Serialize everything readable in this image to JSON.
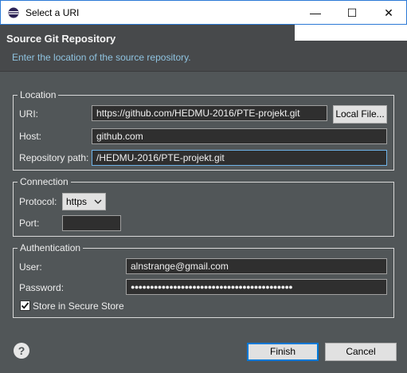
{
  "window": {
    "title": "Select a URI",
    "minimize_glyph": "—",
    "maximize_glyph": "☐",
    "close_glyph": "✕"
  },
  "banner": {
    "heading": "Source Git Repository",
    "description": "Enter the location of the source repository."
  },
  "location": {
    "legend": "Location",
    "uri_label": "URI:",
    "uri_value": "https://github.com/HEDMU-2016/PTE-projekt.git",
    "local_file_label": "Local File...",
    "host_label": "Host:",
    "host_value": "github.com",
    "repo_path_label": "Repository path:",
    "repo_path_value": "/HEDMU-2016/PTE-projekt.git"
  },
  "connection": {
    "legend": "Connection",
    "protocol_label": "Protocol:",
    "protocol_value": "https",
    "port_label": "Port:",
    "port_value": ""
  },
  "authentication": {
    "legend": "Authentication",
    "user_label": "User:",
    "user_value": "alnstrange@gmail.com",
    "password_label": "Password:",
    "password_value": "●●●●●●●●●●●●●●●●●●●●●●●●●●●●●●●●●●●●●●●●●●",
    "store_label": "Store in Secure Store",
    "store_checked": true
  },
  "footer": {
    "help_glyph": "?",
    "finish_label": "Finish",
    "cancel_label": "Cancel"
  },
  "colors": {
    "background": "#515658",
    "accent": "#0078d7",
    "description": "#8fc3e0"
  }
}
